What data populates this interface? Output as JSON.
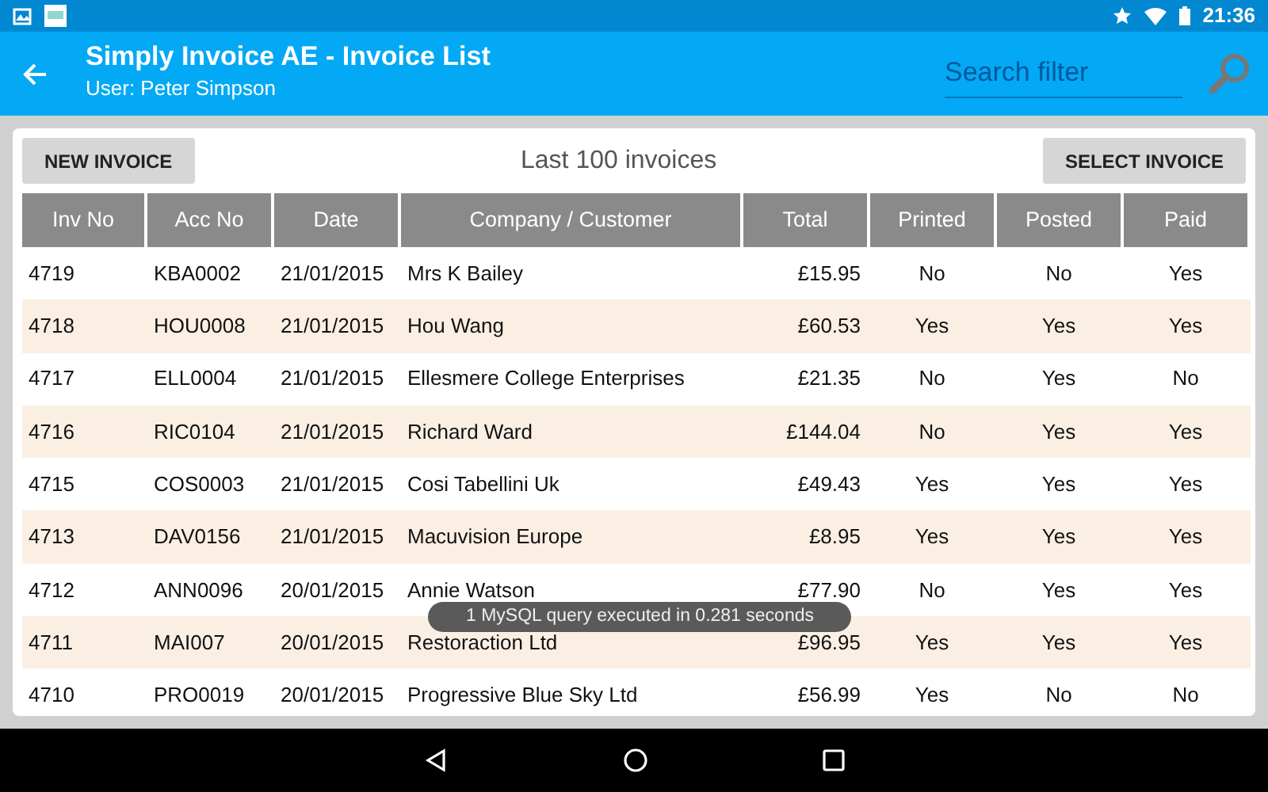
{
  "status_bar": {
    "time": "21:36"
  },
  "app_bar": {
    "title": "Simply Invoice AE - Invoice List",
    "subtitle": "User: Peter Simpson",
    "search": {
      "placeholder": "Search filter"
    }
  },
  "toolbar": {
    "new_button": "NEW INVOICE",
    "heading": "Last 100 invoices",
    "select_button": "SELECT INVOICE"
  },
  "table": {
    "columns": [
      "Inv No",
      "Acc No",
      "Date",
      "Company / Customer",
      "Total",
      "Printed",
      "Posted",
      "Paid"
    ],
    "rows": [
      [
        "4719",
        "KBA0002",
        "21/01/2015",
        "Mrs K Bailey",
        "£15.95",
        "No",
        "No",
        "Yes"
      ],
      [
        "4718",
        "HOU0008",
        "21/01/2015",
        "Hou Wang",
        "£60.53",
        "Yes",
        "Yes",
        "Yes"
      ],
      [
        "4717",
        "ELL0004",
        "21/01/2015",
        "Ellesmere College Enterprises",
        "£21.35",
        "No",
        "Yes",
        "No"
      ],
      [
        "4716",
        "RIC0104",
        "21/01/2015",
        "Richard Ward",
        "£144.04",
        "No",
        "Yes",
        "Yes"
      ],
      [
        "4715",
        "COS0003",
        "21/01/2015",
        "Cosi Tabellini Uk",
        "£49.43",
        "Yes",
        "Yes",
        "Yes"
      ],
      [
        "4713",
        "DAV0156",
        "21/01/2015",
        "Macuvision Europe",
        "£8.95",
        "Yes",
        "Yes",
        "Yes"
      ],
      [
        "4712",
        "ANN0096",
        "20/01/2015",
        "Annie Watson",
        "£77.90",
        "No",
        "Yes",
        "Yes"
      ],
      [
        "4711",
        "MAI007",
        "20/01/2015",
        "Restoraction Ltd",
        "£96.95",
        "Yes",
        "Yes",
        "Yes"
      ],
      [
        "4710",
        "PRO0019",
        "20/01/2015",
        "Progressive Blue Sky Ltd",
        "£56.99",
        "Yes",
        "No",
        "No"
      ]
    ]
  },
  "toast": "1 MySQL query executed in 0.281 seconds"
}
